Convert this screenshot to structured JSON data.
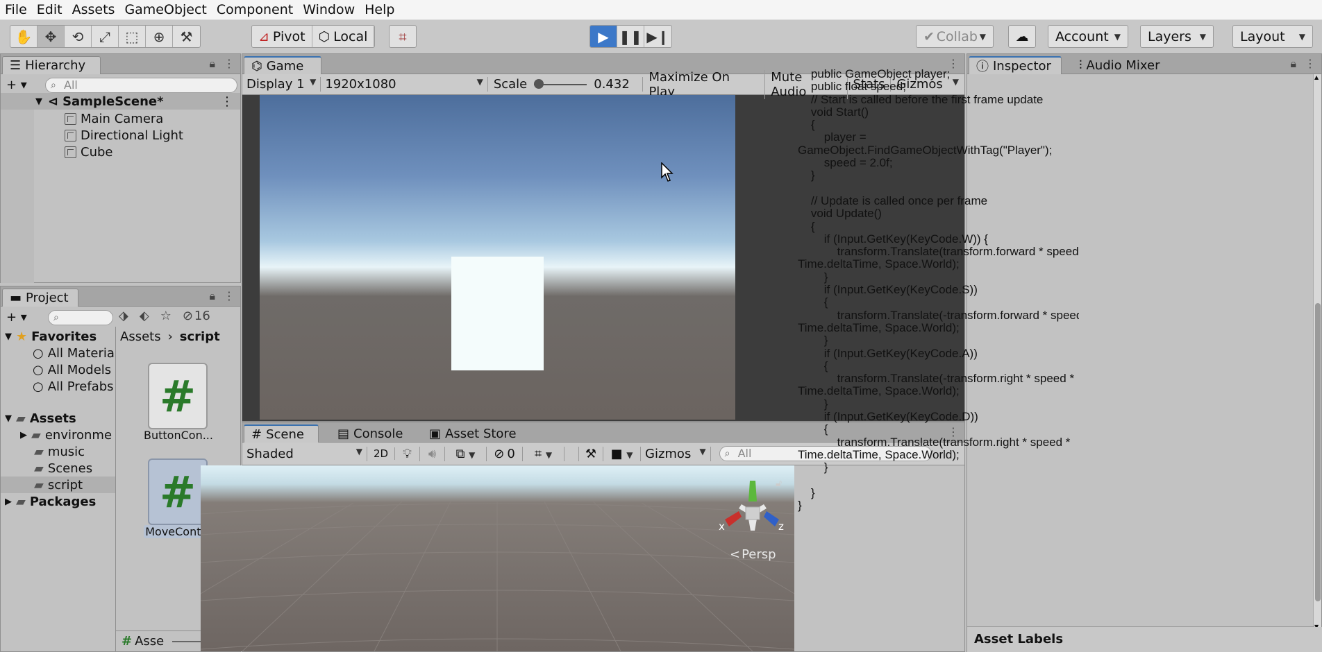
{
  "menu": [
    "File",
    "Edit",
    "Assets",
    "GameObject",
    "Component",
    "Window",
    "Help"
  ],
  "toolbar": {
    "pivot_label": "Pivot",
    "local_label": "Local",
    "collab_label": "Collab",
    "account_label": "Account",
    "layers_label": "Layers",
    "layout_label": "Layout",
    "play_color": "#3c78c8"
  },
  "hierarchy": {
    "tab_label": "Hierarchy",
    "search_placeholder": "All",
    "scene_name": "SampleScene*",
    "objects": [
      "Main Camera",
      "Directional Light",
      "Cube"
    ]
  },
  "project": {
    "tab_label": "Project",
    "hidden_count": "16",
    "favorites_label": "Favorites",
    "favorites": [
      "All Materia",
      "All Models",
      "All Prefabs"
    ],
    "assets_label": "Assets",
    "asset_folders": [
      "environme",
      "music",
      "Scenes",
      "script"
    ],
    "packages_label": "Packages",
    "breadcrumb_root": "Assets",
    "breadcrumb_current": "script",
    "files": [
      "ButtonCon...",
      "MoveCont..."
    ],
    "footer_label": "Asse"
  },
  "game": {
    "tab_label": "Game",
    "display": "Display 1",
    "resolution": "1920x1080",
    "scale_label": "Scale",
    "scale_value": "0.432",
    "maximize_label": "Maximize On Play",
    "mute_label": "Mute Audio",
    "stats_label": "Stats",
    "gizmos_label": "Gizmos"
  },
  "scene": {
    "tabs": [
      "Scene",
      "Console",
      "Asset Store"
    ],
    "shading": "Shaded",
    "mode_2d": "2D",
    "hidden_count": "0",
    "gizmos_label": "Gizmos",
    "search_placeholder": "All",
    "persp_label": "Persp",
    "axis_x": "x",
    "axis_z": "z"
  },
  "inspector": {
    "tabs": [
      "Inspector",
      "Audio Mixer"
    ],
    "code_lines": [
      "    public GameObject player;",
      "    public float speed;",
      "    // Start is called before the first frame update",
      "    void Start()",
      "    {",
      "        player =",
      "GameObject.FindGameObjectWithTag(\"Player\");",
      "        speed = 2.0f;",
      "    }",
      "",
      "    // Update is called once per frame",
      "    void Update()",
      "    {",
      "        if (Input.GetKey(KeyCode.W)) {",
      "            transform.Translate(transform.forward * speed *",
      "Time.deltaTime, Space.World);",
      "        }",
      "        if (Input.GetKey(KeyCode.S))",
      "        {",
      "            transform.Translate(-transform.forward * speed *",
      "Time.deltaTime, Space.World);",
      "        }",
      "        if (Input.GetKey(KeyCode.A))",
      "        {",
      "            transform.Translate(-transform.right * speed *",
      "Time.deltaTime, Space.World);",
      "        }",
      "        if (Input.GetKey(KeyCode.D))",
      "        {",
      "            transform.Translate(transform.right * speed *",
      "Time.deltaTime, Space.World);",
      "        }",
      "",
      "    }",
      "}"
    ],
    "asset_labels": "Asset Labels"
  }
}
